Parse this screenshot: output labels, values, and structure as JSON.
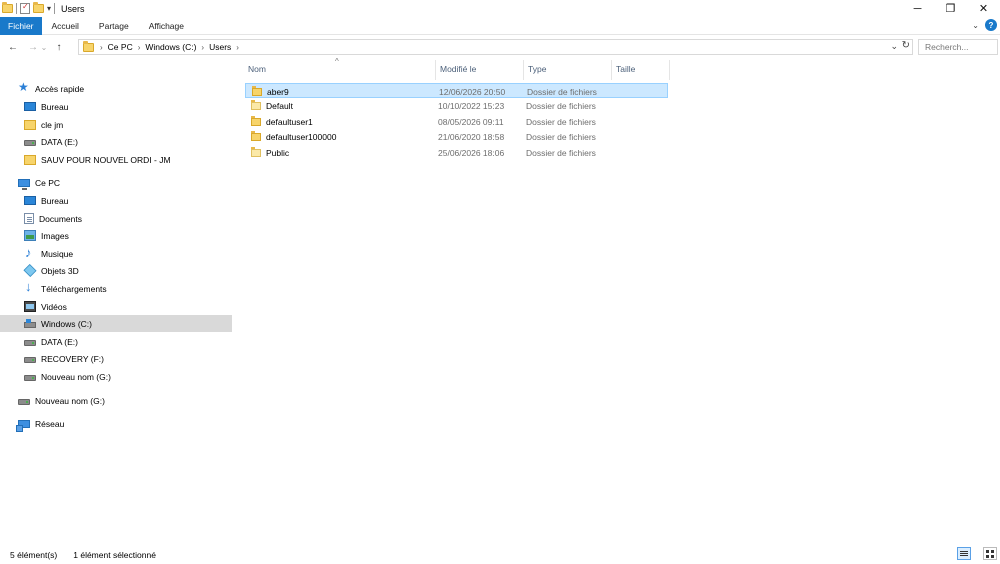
{
  "window": {
    "title": "Users",
    "controls": {
      "minimize": "─",
      "restore": "❐",
      "close": "✕"
    }
  },
  "ribbon": {
    "tabs": [
      {
        "label": "Fichier",
        "active": true
      },
      {
        "label": "Accueil"
      },
      {
        "label": "Partage"
      },
      {
        "label": "Affichage"
      }
    ],
    "help": "?"
  },
  "nav": {
    "back": "←",
    "forward": "→",
    "recent": "⌄",
    "up": "↑",
    "breadcrumb": [
      "Ce PC",
      "Windows (C:)",
      "Users"
    ],
    "search_placeholder": "Recherch...",
    "refresh": "↻",
    "dropdown": "⌄"
  },
  "navpane": {
    "items": [
      {
        "label": "Accès rapide",
        "icon": "star-icon",
        "indent": 0
      },
      {
        "label": "Bureau",
        "icon": "desktop-icon",
        "indent": 1
      },
      {
        "label": "cle jm",
        "icon": "folder-icon",
        "indent": 1
      },
      {
        "label": "DATA (E:)",
        "icon": "drive-icon",
        "indent": 1
      },
      {
        "label": "SAUV POUR NOUVEL ORDI - JM",
        "icon": "folder-icon",
        "indent": 1
      },
      {
        "label": "Ce PC",
        "icon": "pc-icon",
        "indent": 0
      },
      {
        "label": "Bureau",
        "icon": "desktop-icon",
        "indent": 1
      },
      {
        "label": "Documents",
        "icon": "documents-icon",
        "indent": 1
      },
      {
        "label": "Images",
        "icon": "images-icon",
        "indent": 1
      },
      {
        "label": "Musique",
        "icon": "music-icon",
        "indent": 1
      },
      {
        "label": "Objets 3D",
        "icon": "objects-3d-icon",
        "indent": 1
      },
      {
        "label": "Téléchargements",
        "icon": "downloads-icon",
        "indent": 1
      },
      {
        "label": "Vidéos",
        "icon": "videos-icon",
        "indent": 1
      },
      {
        "label": "Windows (C:)",
        "icon": "windows-drive-icon",
        "indent": 1,
        "selected": true
      },
      {
        "label": "DATA (E:)",
        "icon": "drive-icon",
        "indent": 1
      },
      {
        "label": "RECOVERY (F:)",
        "icon": "drive-icon",
        "indent": 1
      },
      {
        "label": "Nouveau nom (G:)",
        "icon": "drive-icon",
        "indent": 1
      },
      {
        "label": "Nouveau nom (G:)",
        "icon": "drive-icon",
        "indent": 0
      },
      {
        "label": "Réseau",
        "icon": "network-icon",
        "indent": 0
      }
    ]
  },
  "filelist": {
    "columns": {
      "name": "Nom",
      "modified": "Modifié le",
      "type": "Type",
      "size": "Taille"
    },
    "sort_indicator": "^",
    "rows": [
      {
        "name": "aber9",
        "modified": "12/06/2026 20:50",
        "type": "Dossier de fichiers",
        "selected": true
      },
      {
        "name": "Default",
        "modified": "10/10/2022 15:23",
        "type": "Dossier de fichiers"
      },
      {
        "name": "defaultuser1",
        "modified": "08/05/2026 09:11",
        "type": "Dossier de fichiers"
      },
      {
        "name": "defaultuser100000",
        "modified": "21/06/2020 18:58",
        "type": "Dossier de fichiers"
      },
      {
        "name": "Public",
        "modified": "25/06/2026 18:06",
        "type": "Dossier de fichiers"
      }
    ]
  },
  "status": {
    "count": "5 élément(s)",
    "selected": "1 élément sélectionné"
  }
}
